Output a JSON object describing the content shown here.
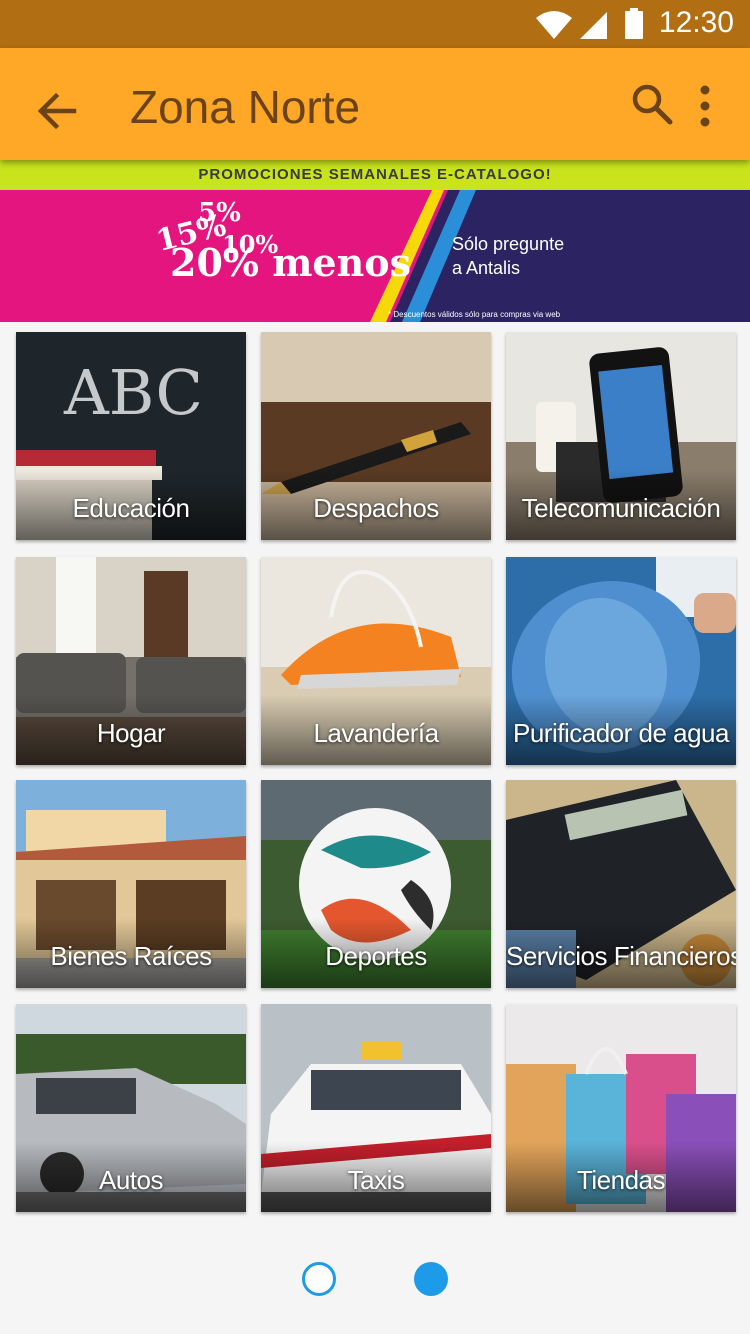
{
  "status_bar": {
    "time": "12:30"
  },
  "app_bar": {
    "title": "Zona Norte"
  },
  "promo": {
    "strip_text": "PROMOCIONES SEMANALES E-CATALOGO!",
    "percent_5": "5%",
    "percent_15": "15%",
    "percent_10": "10%",
    "headline": "20% menos",
    "ask_line1": "Sólo pregunte",
    "ask_line2": "a Antalis",
    "footnote": "* Descuentos válidos sólo para compras via web"
  },
  "categories": [
    {
      "label": "Educación",
      "icon": "chalkboard-abc"
    },
    {
      "label": "Despachos",
      "icon": "fountain-pen"
    },
    {
      "label": "Telecomunicación",
      "icon": "smartphone"
    },
    {
      "label": "Hogar",
      "icon": "living-room"
    },
    {
      "label": "Lavandería",
      "icon": "iron"
    },
    {
      "label": "Purificador de agua",
      "icon": "water-jug"
    },
    {
      "label": "Bienes Raíces",
      "icon": "house"
    },
    {
      "label": "Deportes",
      "icon": "soccer-ball"
    },
    {
      "label": "Servicios Financieros",
      "icon": "calculator"
    },
    {
      "label": "Autos",
      "icon": "car"
    },
    {
      "label": "Taxis",
      "icon": "taxi"
    },
    {
      "label": "Tiendas",
      "icon": "shopping-bags"
    }
  ],
  "pager": {
    "pages": 2,
    "active_page": 2
  },
  "colors": {
    "status_bar": "#b26e12",
    "app_bar": "#ffa726",
    "app_bar_text": "#6a4319",
    "dot_active": "#1e9be8"
  }
}
